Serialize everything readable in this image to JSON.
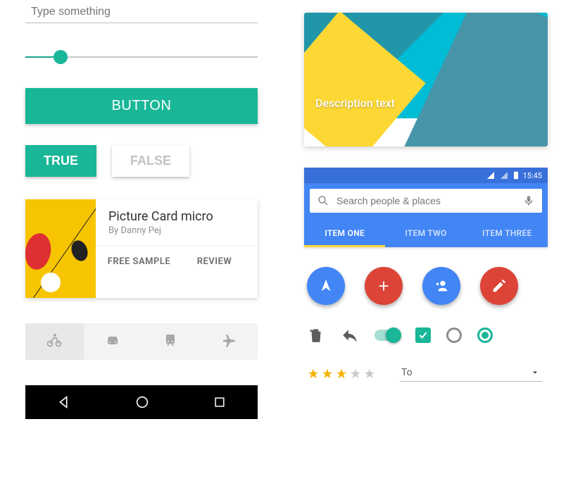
{
  "left": {
    "input_placeholder": "Type something",
    "button_label": "BUTTON",
    "true_label": "TRUE",
    "false_label": "FALSE",
    "card": {
      "title": "Picture Card micro",
      "subtitle": "By Danny Pej",
      "action1": "FREE SAMPLE",
      "action2": "REVIEW"
    }
  },
  "right": {
    "hero_desc": "Description text",
    "status_time": "15:45",
    "search_placeholder": "Search people & places",
    "tabs": {
      "0": "ITEM ONE",
      "1": "ITEM TWO",
      "2": "ITEM THREE"
    },
    "dropdown_value": "To",
    "rating": 3,
    "rating_max": 5
  }
}
